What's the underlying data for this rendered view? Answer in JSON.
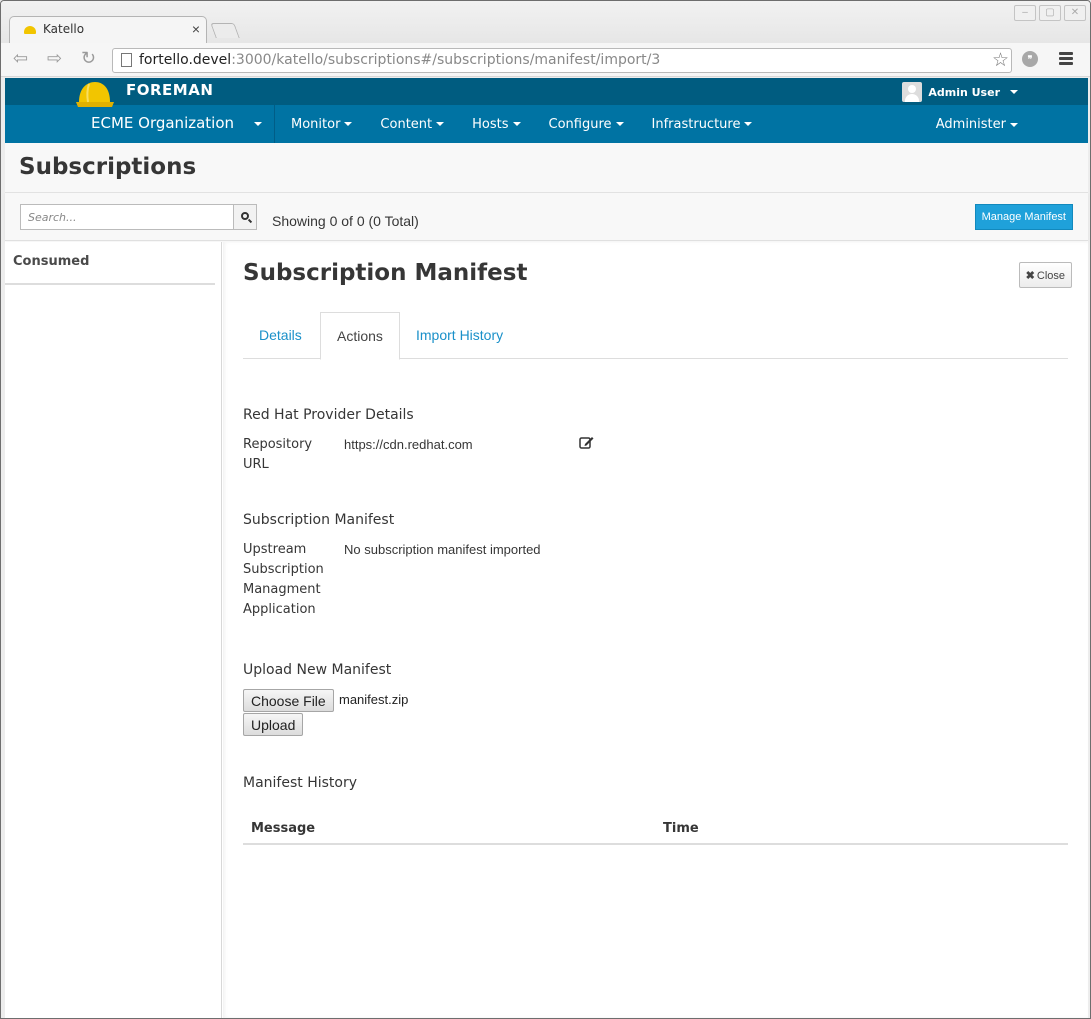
{
  "browser": {
    "tab_title": "Katello",
    "url_host": "fortello.devel",
    "url_rest": ":3000/katello/subscriptions#/subscriptions/manifest/import/3"
  },
  "topbar": {
    "brand": "FOREMAN",
    "user_name": "Admin User"
  },
  "navbar": {
    "organization": "ECME Organization",
    "items": [
      {
        "label": "Monitor"
      },
      {
        "label": "Content"
      },
      {
        "label": "Hosts"
      },
      {
        "label": "Configure"
      },
      {
        "label": "Infrastructure"
      }
    ],
    "admin_label": "Administer"
  },
  "page": {
    "title": "Subscriptions",
    "search_placeholder": "Search...",
    "showing_text": "Showing 0 of 0 (0 Total)",
    "manage_manifest_label": "Manage Manifest"
  },
  "sidebar": {
    "column_header": "Consumed"
  },
  "panel": {
    "title": "Subscription Manifest",
    "close_label": "Close",
    "tabs": [
      {
        "label": "Details",
        "active": false
      },
      {
        "label": "Actions",
        "active": true
      },
      {
        "label": "Import History",
        "active": false
      }
    ],
    "provider": {
      "heading": "Red Hat Provider Details",
      "repo_label": "Repository URL",
      "repo_value": "https://cdn.redhat.com"
    },
    "manifest": {
      "heading": "Subscription Manifest",
      "upstream_label": "Upstream Subscription Managment Application",
      "upstream_value": "No subscription manifest imported"
    },
    "upload": {
      "heading": "Upload New Manifest",
      "choose_file_label": "Choose File",
      "file_name": "manifest.zip",
      "upload_label": "Upload"
    },
    "history": {
      "heading": "Manifest History",
      "columns": [
        "Message",
        "Time"
      ],
      "rows": []
    }
  },
  "colors": {
    "topbar": "#005c80",
    "navbar": "#0073a3",
    "primary_button": "#1fa1da",
    "link": "#1a90c9"
  }
}
